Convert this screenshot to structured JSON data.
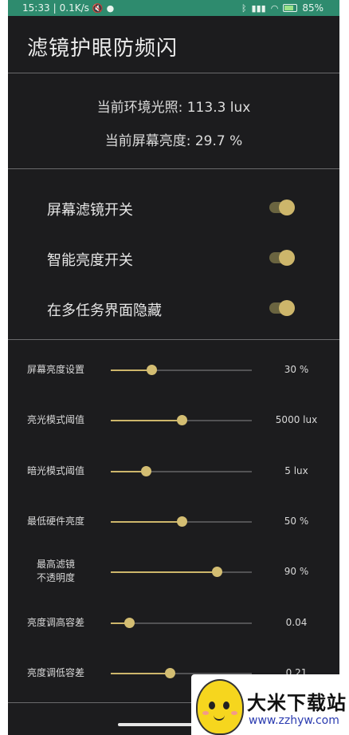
{
  "status_bar": {
    "time": "15:33",
    "net_speed": "0.1K/s",
    "battery": "85%",
    "icons": [
      "mute-icon",
      "wechat-icon",
      "bluetooth-icon",
      "signal-icon",
      "wifi-icon",
      "battery-icon"
    ]
  },
  "header": {
    "title": "滤镜护眼防频闪"
  },
  "info": {
    "ambient_light": "当前环境光照: 113.3 lux",
    "screen_brightness": "当前屏幕亮度: 29.7 %"
  },
  "switches": [
    {
      "label": "屏幕滤镜开关",
      "on": true
    },
    {
      "label": "智能亮度开关",
      "on": true
    },
    {
      "label": "在多任务界面隐藏",
      "on": true
    }
  ],
  "sliders": [
    {
      "label": "屏幕亮度设置",
      "value": "30 %",
      "fraction": 0.29
    },
    {
      "label": "亮光模式阈值",
      "value": "5000 lux",
      "fraction": 0.5
    },
    {
      "label": "暗光模式阈值",
      "value": "5 lux",
      "fraction": 0.25
    },
    {
      "label": "最低硬件亮度",
      "value": "50 %",
      "fraction": 0.5
    },
    {
      "label": "最高滤镜\n不透明度",
      "value": "90 %",
      "fraction": 0.75
    },
    {
      "label": "亮度调高容差",
      "value": "0.04",
      "fraction": 0.13
    },
    {
      "label": "亮度调低容差",
      "value": "0.21",
      "fraction": 0.42
    }
  ],
  "watermark": {
    "name": "大米下载站",
    "url": "www.zzhyw.com"
  },
  "colors": {
    "accent": "#cdb66b",
    "background": "#1c1c1e",
    "status_bar": "#2e8b6e"
  }
}
